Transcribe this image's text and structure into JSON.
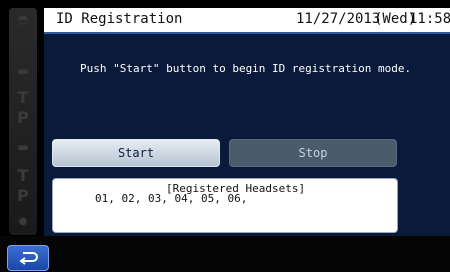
{
  "header": {
    "title": "ID Registration",
    "date": "11/27/2013",
    "day": "(Wed)",
    "time": "11:58"
  },
  "main": {
    "instruction": "Push \"Start\" button to begin ID registration mode.",
    "start_label": "Start",
    "stop_label": "Stop",
    "registered_title": "[Registered Headsets]",
    "registered_list": "01, 02, 03, 04, 05, 06,"
  },
  "sidebar": {
    "icons": [
      "headset-icon",
      "car-icon",
      "letter-t-icon",
      "letter-p-icon",
      "car-icon",
      "letter-t-icon",
      "letter-p-icon",
      "settings-icon"
    ],
    "letters": [
      "T",
      "P",
      "T",
      "P"
    ]
  },
  "footer": {
    "back_icon": "return-arrow-icon"
  },
  "colors": {
    "background": "#0a1a3a",
    "header_separator": "#2d5a9a",
    "start_button": "#dbe3ec",
    "stop_button": "#4a5b6c",
    "back_button": "#2a5bc0"
  }
}
